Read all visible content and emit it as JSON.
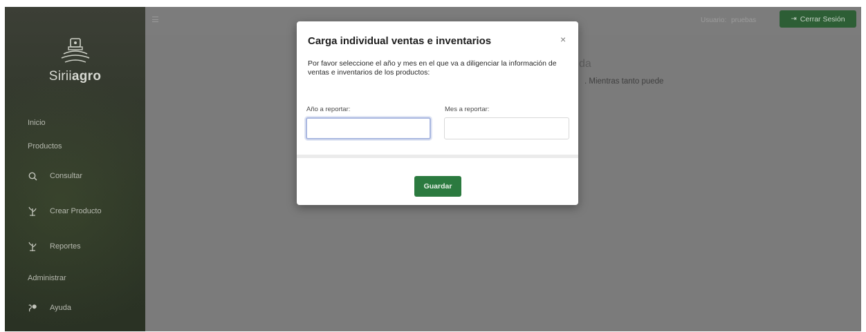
{
  "app": {
    "brand_prefix": "Sirii",
    "brand_suffix": "agro"
  },
  "sidebar": {
    "items": [
      {
        "label": "Inicio",
        "icon": "none"
      },
      {
        "label": "Productos",
        "icon": "none"
      },
      {
        "label": "Consultar",
        "icon": "search-icon"
      },
      {
        "label": "Crear Producto",
        "icon": "plant-icon"
      },
      {
        "label": "Reportes",
        "icon": "plant-icon"
      },
      {
        "label": "Administrar",
        "icon": "none"
      },
      {
        "label": "Ayuda",
        "icon": "help-icon"
      }
    ]
  },
  "header": {
    "user_label": "Usuario:",
    "user_name": "pruebas",
    "logout_label": "Cerrar Sesión",
    "logout_icon": "sign-out-icon"
  },
  "background": {
    "title_fragment": "da",
    "text_fragment": ". Mientras tanto puede"
  },
  "modal": {
    "title": "Carga individual ventas e inventarios",
    "close_glyph": "×",
    "description": "Por favor seleccione el año y mes en el que va a diligenciar la información de ventas e inventarios de los productos:",
    "year_label": "Año a reportar:",
    "year_value": "",
    "month_label": "Mes a reportar:",
    "month_value": "",
    "save_label": "Guardar"
  },
  "colors": {
    "overlay": "#7b7b7b",
    "sidebar": "#2f3628",
    "logout_bg": "#2d5e35",
    "save_bg": "#2b7a3f",
    "focus_ring": "#a9b7e0"
  }
}
